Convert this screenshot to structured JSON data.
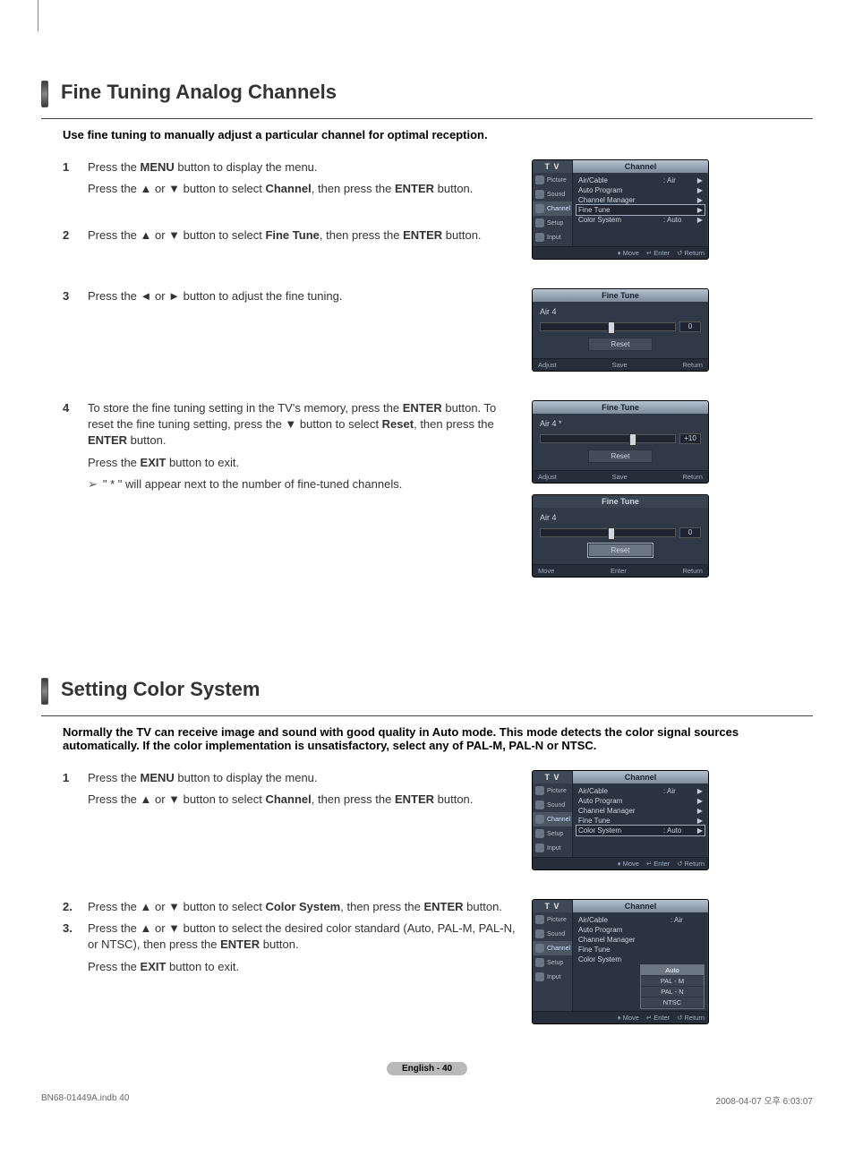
{
  "section1": {
    "title": "Fine Tuning Analog Channels",
    "intro": "Use fine tuning to manually adjust a particular channel for optimal reception.",
    "steps": {
      "s1n": "1",
      "s1a": "Press the ",
      "s1b": "MENU",
      "s1c": " button to display the menu.",
      "s1d": "Press the ▲ or ▼ button to select ",
      "s1e": "Channel",
      "s1f": ", then press the ",
      "s1g": "ENTER",
      "s1h": " button.",
      "s2n": "2",
      "s2a": "Press the ▲ or ▼ button to select ",
      "s2b": "Fine Tune",
      "s2c": ", then press the ",
      "s2d": "ENTER",
      "s2e": " button.",
      "s3n": "3",
      "s3a": "Press the ◄ or ► button to adjust the fine tuning.",
      "s4n": "4",
      "s4a": "To store the fine tuning setting in the TV's memory, press the ",
      "s4b": "ENTER",
      "s4c": " button. To reset the fine tuning setting, press the ▼ button to select ",
      "s4d": "Reset",
      "s4e": ", then press the ",
      "s4f": "ENTER",
      "s4g": " button.",
      "s4h": "Press the ",
      "s4i": "EXIT",
      "s4j": " button to exit.",
      "tip": "\" * \" will appear next to the number of fine-tuned channels."
    }
  },
  "section2": {
    "title": "Setting Color System",
    "intro": "Normally the TV can receive image and sound with good quality in Auto mode. This mode detects the color signal sources automatically. If the color implementation is unsatisfactory, select any of PAL-M, PAL-N or NTSC.",
    "steps": {
      "s1n": "1",
      "s1a": "Press the ",
      "s1b": "MENU",
      "s1c": " button to display the menu.",
      "s1d": "Press the ▲ or ▼ button to select ",
      "s1e": "Channel",
      "s1f": ", then press the ",
      "s1g": "ENTER",
      "s1h": " button.",
      "s2n": "2.",
      "s2a": "Press the ▲ or ▼ button to select ",
      "s2b": "Color System",
      "s2c": ", then press the ",
      "s2d": "ENTER",
      "s2e": " button.",
      "s3n": "3.",
      "s3a": "Press the ▲ or ▼ button to select the desired color standard (Auto, PAL-M, PAL-N, or NTSC), then press the ",
      "s3b": "ENTER",
      "s3c": " button.",
      "s3d": "Press the ",
      "s3e": "EXIT",
      "s3f": " button to exit."
    }
  },
  "osd": {
    "tv": "T V",
    "channel": "Channel",
    "finetune": "Fine Tune",
    "side": {
      "picture": "Picture",
      "sound": "Sound",
      "channel": "Channel",
      "setup": "Setup",
      "input": "Input"
    },
    "items": {
      "aircable": "Air/Cable",
      "autoprog": "Auto Program",
      "chanmgr": "Channel Manager",
      "finetune": "Fine Tune",
      "colorsys": "Color System",
      "air": ": Air",
      "auto": ": Auto",
      "arrow": "▶"
    },
    "foot": {
      "move": "Move",
      "enter": "Enter",
      "return": "Return",
      "adjust": "Adjust",
      "save": "Save"
    },
    "options": {
      "auto": "Auto",
      "palm": "PAL - M",
      "paln": "PAL - N",
      "ntsc": "NTSC"
    }
  },
  "ft": {
    "ch": "Air  4",
    "chstar": "Air  4 *",
    "reset": "Reset",
    "v0": "0",
    "v10": "+10"
  },
  "footer": {
    "page": "English - 40",
    "file": "BN68-01449A.indb   40",
    "date": "2008-04-07   오후 6:03:07"
  }
}
